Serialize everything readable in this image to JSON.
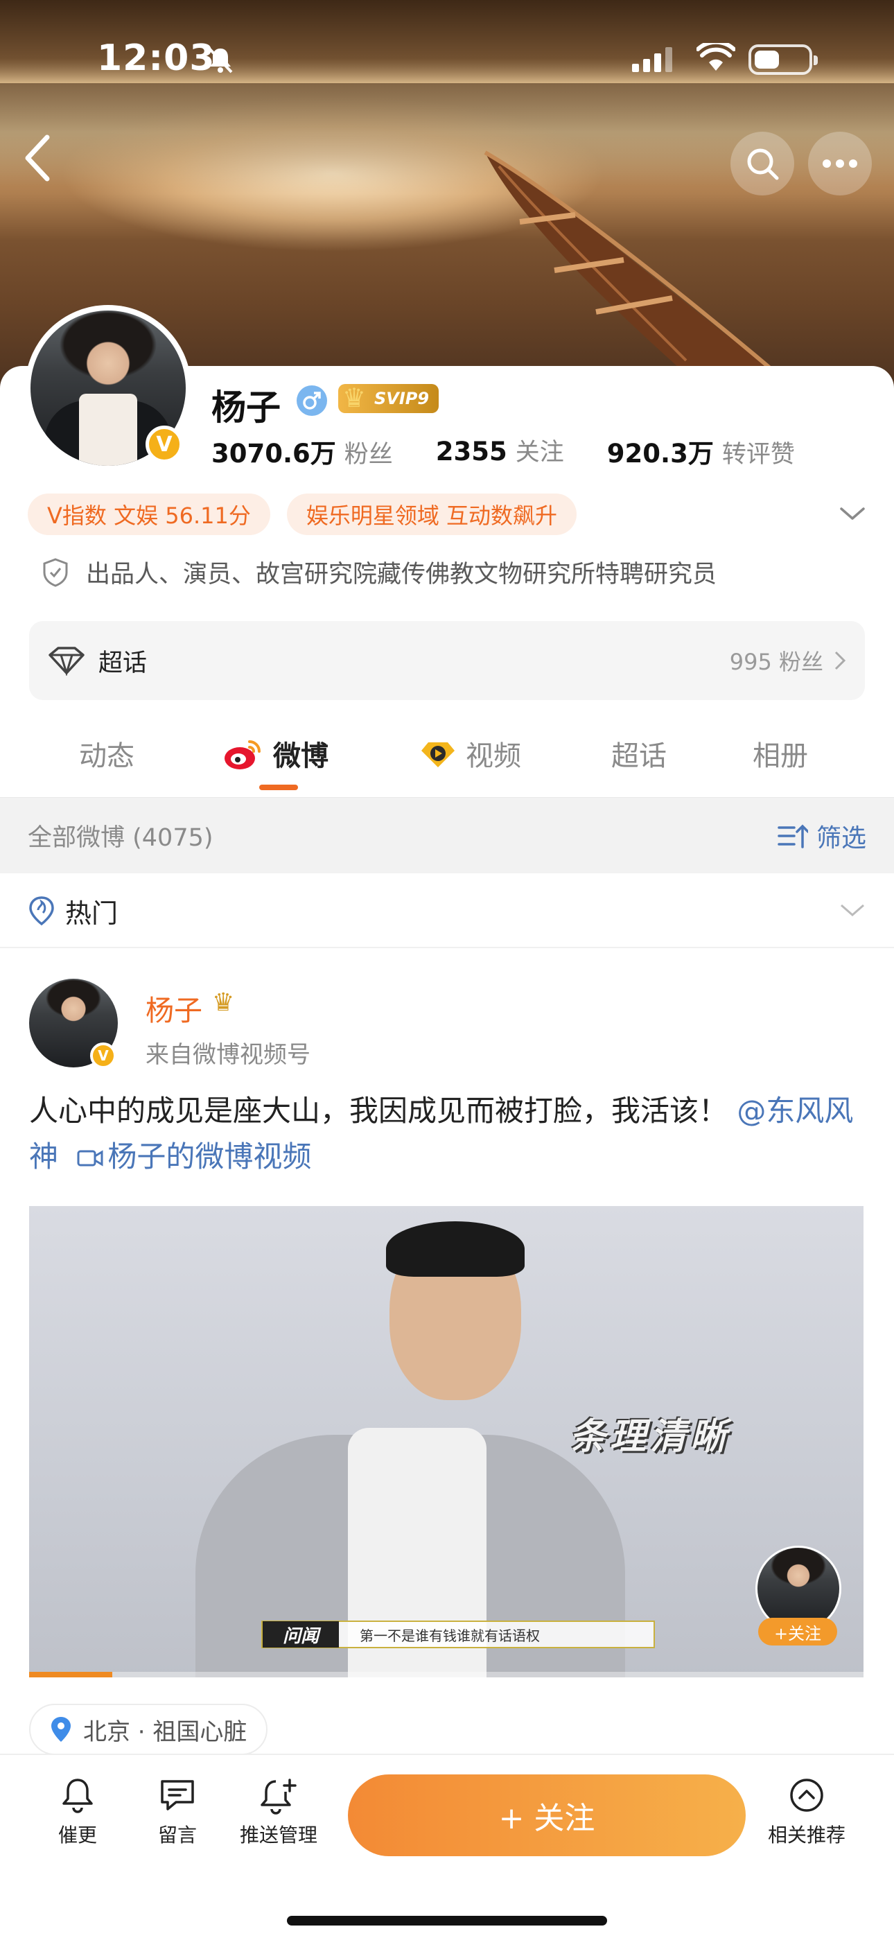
{
  "status_bar": {
    "time": "12:03"
  },
  "profile": {
    "name": "杨子",
    "svip_label": "SVIP9",
    "v_badge": "V",
    "stats": [
      {
        "value": "3070.6万",
        "label": "粉丝"
      },
      {
        "value": "2355",
        "label": "关注"
      },
      {
        "value": "920.3万",
        "label": "转评赞"
      }
    ],
    "tags": [
      "V指数 文娱 56.11分",
      "娱乐明星领域 互动数飙升"
    ],
    "description": "出品人、演员、故宫研究院藏传佛教文物研究所特聘研究员",
    "super_topic": {
      "label": "超话",
      "fans": "995 粉丝"
    }
  },
  "tabs": [
    {
      "label": "动态",
      "active": false
    },
    {
      "label": "微博",
      "active": true
    },
    {
      "label": "视频",
      "active": false
    },
    {
      "label": "超话",
      "active": false
    },
    {
      "label": "相册",
      "active": false
    }
  ],
  "filter": {
    "count_label": "全部微博 (4075)",
    "filter_label": "筛选"
  },
  "hot": {
    "label": "热门"
  },
  "post": {
    "author": "杨子",
    "source": "来自微博视频号",
    "text_main": "人心中的成见是座大山，我因成见而被打脸，我活该！",
    "mention": "@东风风神",
    "video_link": "杨子的微博视频",
    "video": {
      "caption": "条理清晰",
      "brand": "问闻",
      "subtitle": "第一不是谁有钱谁就有话语权",
      "follow_label": "+关注",
      "progress": 0.1
    },
    "location": "北京 · 祖国心脏"
  },
  "bottom_bar": {
    "items": [
      "催更",
      "留言",
      "推送管理",
      "相关推荐"
    ],
    "follow_label": "+ 关注"
  },
  "colors": {
    "accent": "#ef6a22",
    "link": "#4a76b8",
    "follow_start": "#f38a35",
    "follow_end": "#f6b04a"
  }
}
